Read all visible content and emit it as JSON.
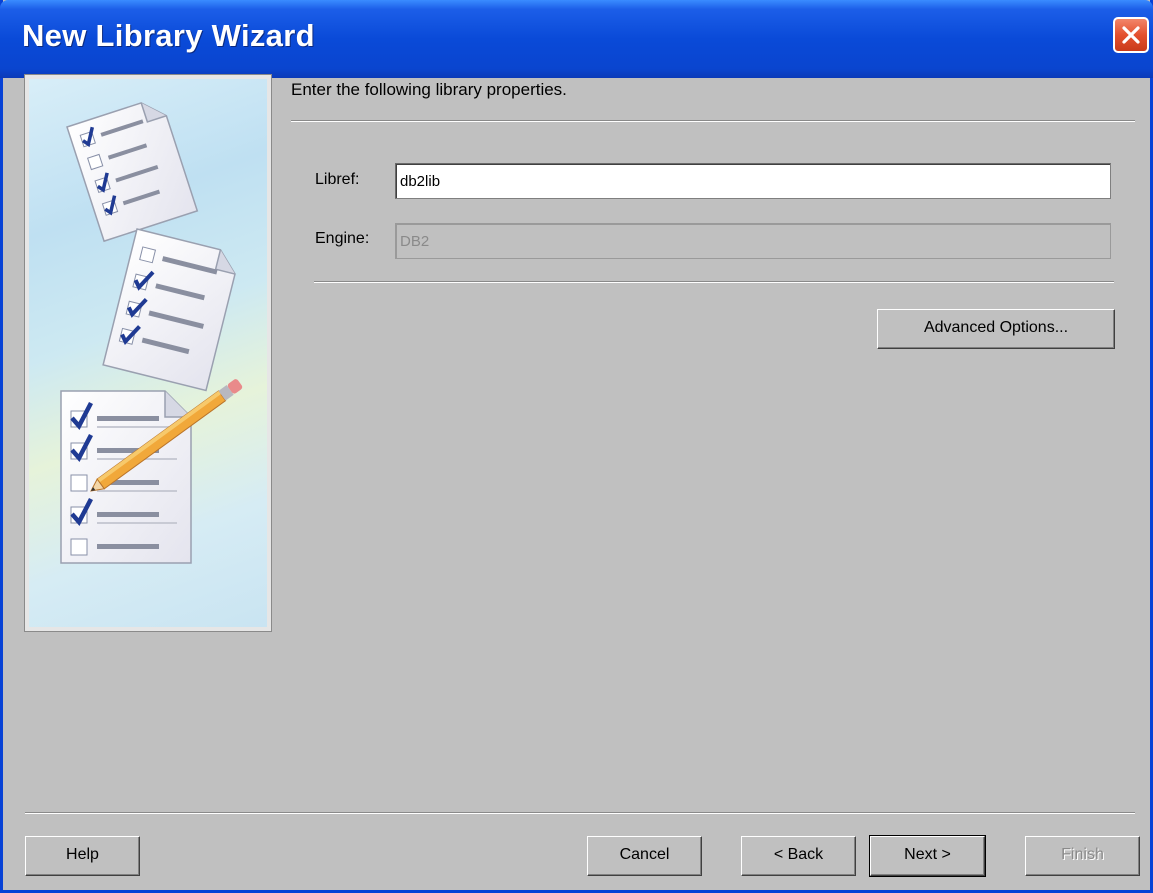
{
  "window": {
    "title": "New Library Wizard"
  },
  "main": {
    "instruction": "Enter the following library properties.",
    "libref": {
      "label": "Libref:",
      "value": "db2lib"
    },
    "engine": {
      "label": "Engine:",
      "value": "DB2"
    },
    "advanced_label": "Advanced Options..."
  },
  "footer": {
    "help_label": "Help",
    "cancel_label": "Cancel",
    "back_label": "< Back",
    "next_label": "Next >",
    "finish_label": "Finish"
  },
  "colors": {
    "titlebar": "#0a4ad8",
    "dialog_bg": "#c0c0c0",
    "check": "#1f3a93",
    "pencil": "#f1a83a"
  },
  "icons": [
    "close-icon",
    "checklist-icon",
    "pencil-icon"
  ]
}
